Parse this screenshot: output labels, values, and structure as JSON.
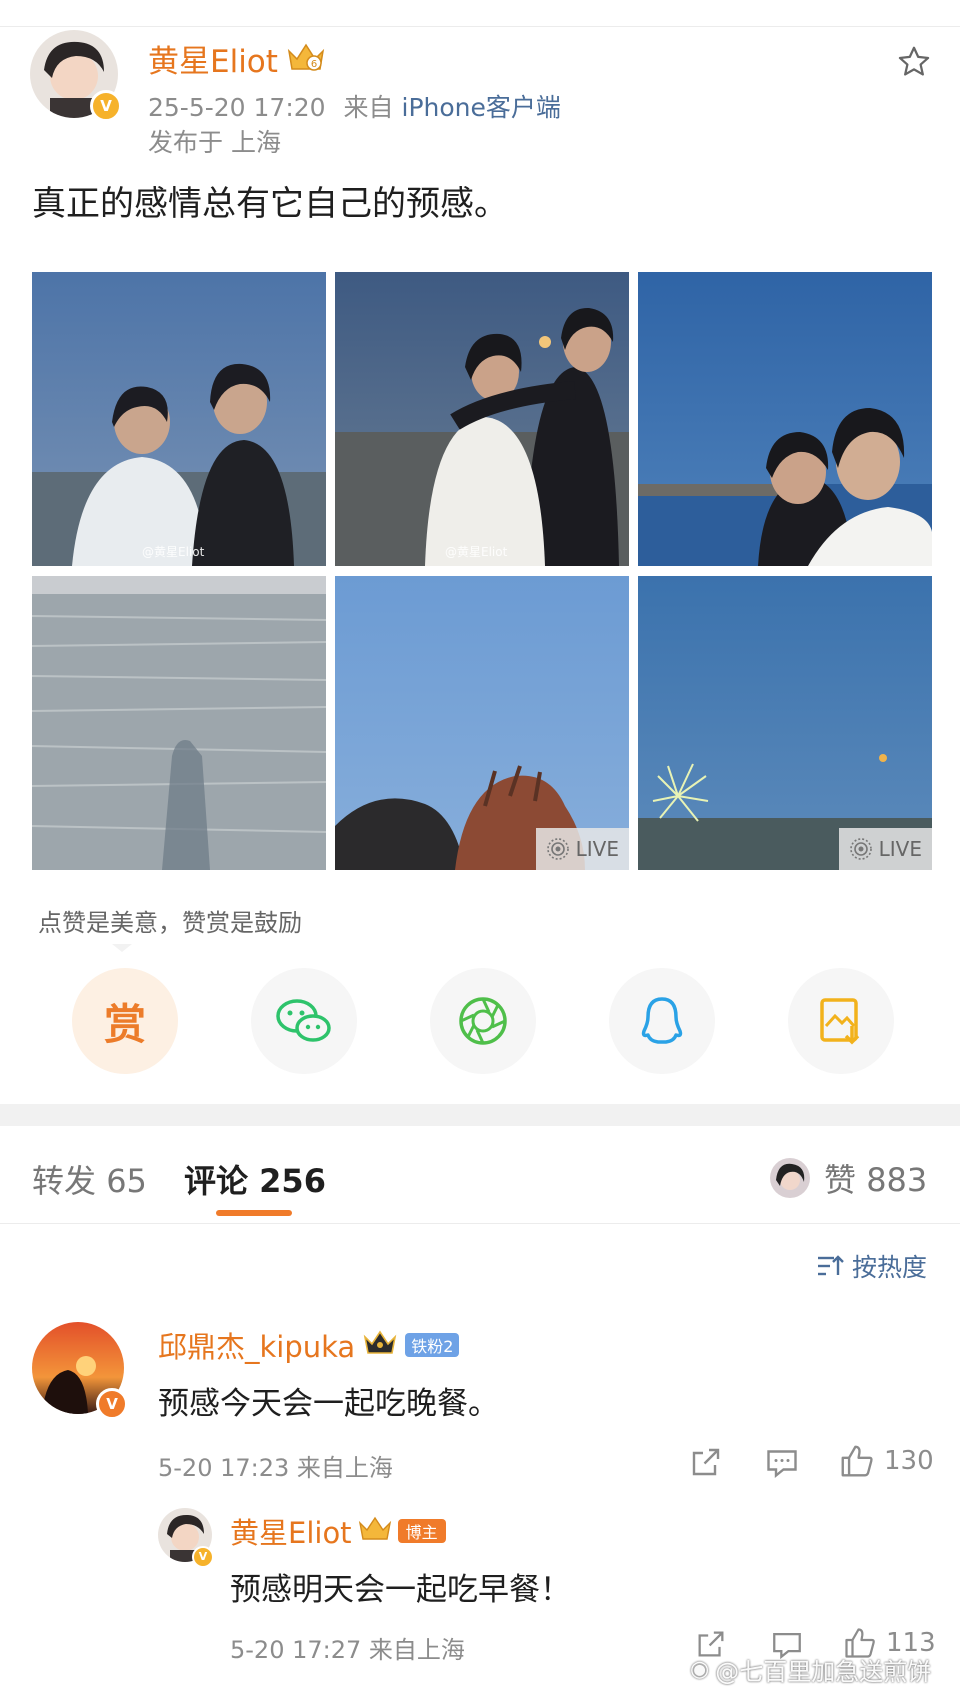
{
  "post": {
    "author": "黄星Eliot",
    "timestamp": "25-5-20 17:20",
    "source_prefix": "来自",
    "source": "iPhone客户端",
    "location": "发布于 上海",
    "text": "真正的感情总有它自己的预感。",
    "watermark": "@黄星Eliot",
    "live_label": "LIVE"
  },
  "reward_hint": "点赞是美意，赞赏是鼓励",
  "share": {
    "reward_label": "赏"
  },
  "stats": {
    "repost_label": "转发",
    "repost_count": "65",
    "comment_label": "评论",
    "comment_count": "256",
    "like_label": "赞",
    "like_count": "883",
    "sort_label": "按热度"
  },
  "comments": [
    {
      "name": "邱鼎杰_kipuka",
      "badge": "铁粉2",
      "text": "预感今天会一起吃晚餐。",
      "meta": "5-20 17:23 来自上海",
      "likes": "130"
    },
    {
      "name": "黄星Eliot",
      "badge": "博主",
      "text": "预感明天会一起吃早餐！",
      "meta": "5-20 17:27 来自上海",
      "likes": "113"
    }
  ],
  "footer_watermark": "@七百里加急送煎饼",
  "colors": {
    "accent": "#e6761e",
    "link": "#4a6d99",
    "wechat": "#2ec36b",
    "moments": "#4fbf4a",
    "qq": "#2aa2e6",
    "save": "#f2b21c"
  }
}
